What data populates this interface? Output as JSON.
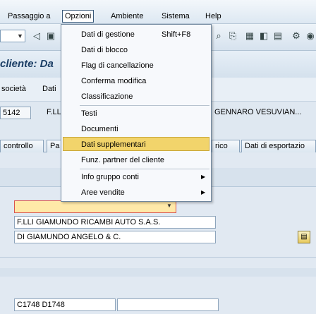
{
  "menubar": {
    "items": [
      {
        "label": "Passaggio a",
        "active": false
      },
      {
        "label": "Opzioni",
        "active": true
      },
      {
        "label": "Ambiente",
        "active": false
      },
      {
        "label": "Sistema",
        "active": false
      },
      {
        "label": "Help",
        "active": false
      }
    ]
  },
  "title": "cliente: Da",
  "app_toolbar": {
    "societa": "società",
    "dati": "Dati"
  },
  "header": {
    "customer_no": "5142",
    "name_short": "F.LL",
    "city": "GENNARO VESUVIAN..."
  },
  "tabs": [
    {
      "label": "controllo"
    },
    {
      "label": "Pa"
    },
    {
      "label": "rico"
    },
    {
      "label": "Dati di esportazio"
    }
  ],
  "form": {
    "name1": "F.LLI GIAMUNDO RICAMBI AUTO S.A.S.",
    "name2": "DI GIAMUNDO ANGELO & C.",
    "search_term": "C1748 D1748"
  },
  "dropdown_menu": {
    "items": [
      {
        "label": "Dati di gestione",
        "shortcut": "Shift+F8",
        "submenu": false,
        "highlighted": false
      },
      {
        "label": "Dati di blocco",
        "shortcut": "",
        "submenu": false,
        "highlighted": false
      },
      {
        "label": "Flag di cancellazione",
        "shortcut": "",
        "submenu": false,
        "highlighted": false
      },
      {
        "label": "Conferma modifica",
        "shortcut": "",
        "submenu": false,
        "highlighted": false
      },
      {
        "label": "Classificazione",
        "shortcut": "",
        "submenu": false,
        "highlighted": false
      },
      {
        "label": "Testi",
        "shortcut": "",
        "submenu": false,
        "highlighted": false
      },
      {
        "label": "Documenti",
        "shortcut": "",
        "submenu": false,
        "highlighted": false
      },
      {
        "label": "Dati supplementari",
        "shortcut": "",
        "submenu": false,
        "highlighted": true
      },
      {
        "label": "Funz. partner del cliente",
        "shortcut": "",
        "submenu": false,
        "highlighted": false
      },
      {
        "label": "Info gruppo conti",
        "shortcut": "",
        "submenu": true,
        "highlighted": false
      },
      {
        "label": "Aree vendite",
        "shortcut": "",
        "submenu": true,
        "highlighted": false
      }
    ]
  },
  "icons": {
    "toolbar": [
      "dropdown-arrow-icon",
      "back-icon",
      "save-icon",
      "find-icon",
      "find-next-icon",
      "layout-icon",
      "layout-alt-icon",
      "help-icon",
      "settings-icon"
    ],
    "f4": "value-help-icon"
  },
  "colors": {
    "menu_highlight": "#f2d46b",
    "title_text": "#1c3f66",
    "required_field": "#ffe9a8"
  }
}
